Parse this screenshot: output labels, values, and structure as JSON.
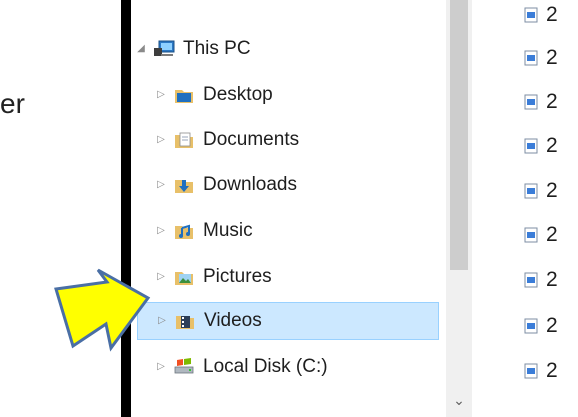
{
  "left_fragment": "er",
  "tree": {
    "items": [
      {
        "label": "This PC",
        "icon": "computer-icon",
        "state": "expanded"
      },
      {
        "label": "Desktop",
        "icon": "desktop-folder-icon",
        "state": "collapsed"
      },
      {
        "label": "Documents",
        "icon": "documents-folder-icon",
        "state": "collapsed"
      },
      {
        "label": "Downloads",
        "icon": "downloads-folder-icon",
        "state": "collapsed"
      },
      {
        "label": "Music",
        "icon": "music-folder-icon",
        "state": "collapsed"
      },
      {
        "label": "Pictures",
        "icon": "pictures-folder-icon",
        "state": "collapsed"
      },
      {
        "label": "Videos",
        "icon": "videos-folder-icon",
        "state": "collapsed",
        "selected": true
      },
      {
        "label": "Local Disk (C:)",
        "icon": "local-disk-icon",
        "state": "collapsed"
      }
    ]
  },
  "scroll_down_glyph": "⌄",
  "file_list": {
    "items": [
      "2",
      "2",
      "2",
      "2",
      "2",
      "2",
      "2",
      "2",
      "2"
    ]
  },
  "colors": {
    "selection_bg": "#cce8ff",
    "selection_border": "#99d1ff",
    "arrow_fill": "#ffff00",
    "arrow_stroke": "#4a6fa5"
  }
}
